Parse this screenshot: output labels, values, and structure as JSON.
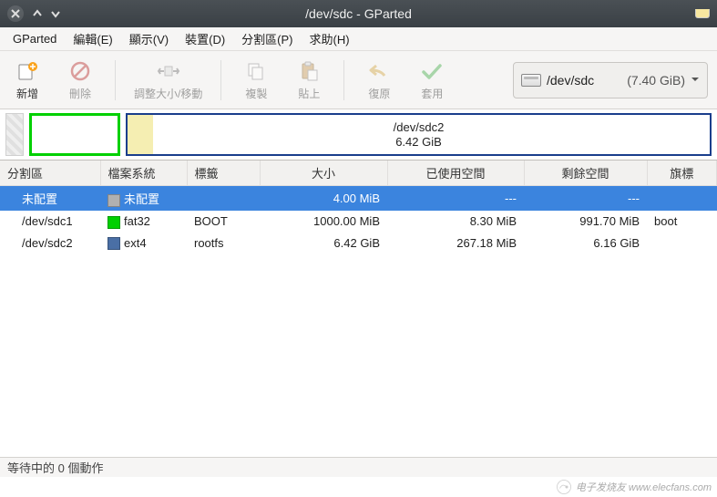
{
  "title": "/dev/sdc - GParted",
  "menus": {
    "gparted": "GParted",
    "edit": "編輯(E)",
    "view": "顯示(V)",
    "device": "裝置(D)",
    "partition": "分割區(P)",
    "help": "求助(H)"
  },
  "toolbar": {
    "new": "新增",
    "delete": "刪除",
    "resize": "調整大小/移動",
    "copy": "複製",
    "paste": "貼上",
    "undo": "復原",
    "apply": "套用"
  },
  "device": {
    "name": "/dev/sdc",
    "size": "(7.40 GiB)"
  },
  "visual": {
    "big_label_line1": "/dev/sdc2",
    "big_label_line2": "6.42 GiB"
  },
  "columns": {
    "partition": "分割區",
    "filesystem": "檔案系統",
    "label": "標籤",
    "size": "大小",
    "used": "已使用空間",
    "free": "剩餘空間",
    "flags": "旗標"
  },
  "rows": [
    {
      "partition": "未配置",
      "fs_swatch": "swatch-unalloc",
      "fs": "未配置",
      "label": "",
      "size": "4.00 MiB",
      "used": "---",
      "free": "---",
      "flags": "",
      "selected": true
    },
    {
      "partition": "/dev/sdc1",
      "fs_swatch": "swatch-fat32",
      "fs": "fat32",
      "label": "BOOT",
      "size": "1000.00 MiB",
      "used": "8.30 MiB",
      "free": "991.70 MiB",
      "flags": "boot",
      "selected": false
    },
    {
      "partition": "/dev/sdc2",
      "fs_swatch": "swatch-ext4",
      "fs": "ext4",
      "label": "rootfs",
      "size": "6.42 GiB",
      "used": "267.18 MiB",
      "free": "6.16 GiB",
      "flags": "",
      "selected": false
    }
  ],
  "statusbar": "等待中的 0 個動作",
  "watermark": "电子发烧友 www.elecfans.com"
}
